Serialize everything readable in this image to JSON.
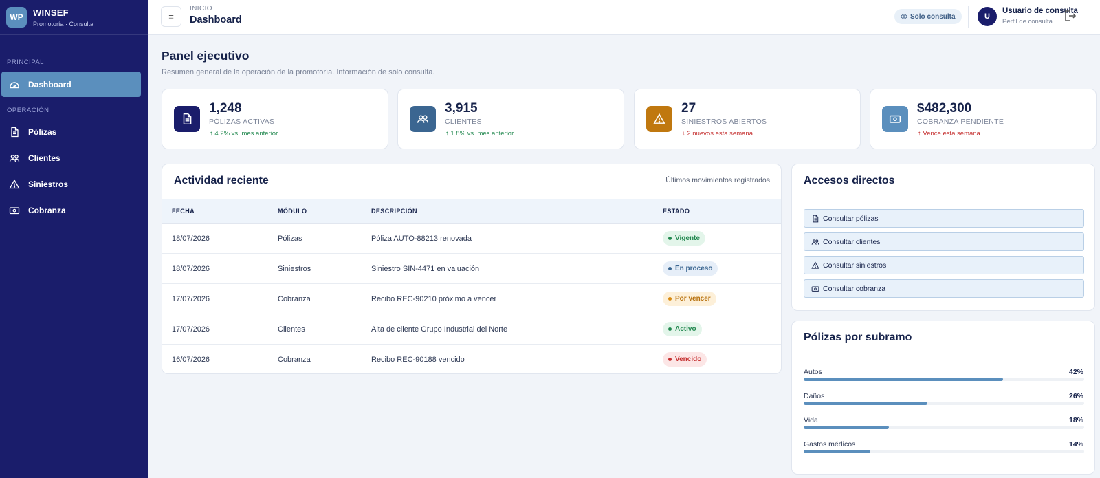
{
  "brand": {
    "logo": "WP",
    "name": "WINSEF",
    "subtitle": "Promotoría · Consulta"
  },
  "sidebar": {
    "section_principal": "PRINCIPAL",
    "section_operacion": "OPERACIÓN",
    "items": [
      {
        "label": "Dashboard",
        "icon": "gauge-icon",
        "active": true
      },
      {
        "label": "Pólizas",
        "icon": "document-icon"
      },
      {
        "label": "Clientes",
        "icon": "users-icon"
      },
      {
        "label": "Siniestros",
        "icon": "warning-icon"
      },
      {
        "label": "Cobranza",
        "icon": "cash-icon"
      }
    ]
  },
  "header": {
    "breadcrumb": "INICIO",
    "title": "Dashboard",
    "readonly_badge": "Solo consulta",
    "user_initial": "U",
    "user_name": "Usuario de consulta",
    "user_role": "Perfil de consulta"
  },
  "main": {
    "title": "Panel ejecutivo",
    "subtitle": "Resumen general de la operación de la promotoría. Información de solo consulta."
  },
  "kpis": [
    {
      "value": "1,248",
      "label": "PÓLIZAS ACTIVAS",
      "trend": "↑ 4.2% vs. mes anterior",
      "direction": "up",
      "icon": "document-icon",
      "color": "#1a1d6b"
    },
    {
      "value": "3,915",
      "label": "CLIENTES",
      "trend": "↑ 1.8% vs. mes anterior",
      "direction": "up",
      "icon": "users-icon",
      "color": "#3b6691"
    },
    {
      "value": "27",
      "label": "SINIESTROS ABIERTOS",
      "trend": "↓ 2 nuevos esta semana",
      "direction": "down",
      "icon": "warning-icon",
      "color": "#c0780f"
    },
    {
      "value": "$482,300",
      "label": "COBRANZA PENDIENTE",
      "trend": "↑ Vence esta semana",
      "direction": "down",
      "icon": "cash-icon",
      "color": "#5b8fbd"
    }
  ],
  "activity": {
    "title": "Actividad reciente",
    "meta": "Últimos movimientos registrados",
    "columns": [
      "FECHA",
      "MÓDULO",
      "DESCRIPCIÓN",
      "ESTADO"
    ],
    "rows": [
      {
        "fecha": "18/07/2026",
        "modulo": "Pólizas",
        "descripcion": "Póliza AUTO-88213 renovada",
        "estado": "Vigente",
        "estado_bg": "#e3f5ea",
        "estado_fg": "#22884f"
      },
      {
        "fecha": "18/07/2026",
        "modulo": "Siniestros",
        "descripcion": "Siniestro SIN-4471 en valuación",
        "estado": "En proceso",
        "estado_bg": "#e6eef8",
        "estado_fg": "#3b6691"
      },
      {
        "fecha": "17/07/2026",
        "modulo": "Cobranza",
        "descripcion": "Recibo REC-90210 próximo a vencer",
        "estado": "Por vencer",
        "estado_bg": "#fdf0d9",
        "estado_fg": "#b7700c"
      },
      {
        "fecha": "17/07/2026",
        "modulo": "Clientes",
        "descripcion": "Alta de cliente Grupo Industrial del Norte",
        "estado": "Activo",
        "estado_bg": "#e3f5ea",
        "estado_fg": "#22884f"
      },
      {
        "fecha": "16/07/2026",
        "modulo": "Cobranza",
        "descripcion": "Recibo REC-90188 vencido",
        "estado": "Vencido",
        "estado_bg": "#fce6e6",
        "estado_fg": "#c53030"
      }
    ]
  },
  "quick_access": {
    "title": "Accesos directos",
    "links": [
      {
        "label": "Consultar pólizas",
        "icon": "document-icon"
      },
      {
        "label": "Consultar clientes",
        "icon": "users-icon"
      },
      {
        "label": "Consultar siniestros",
        "icon": "warning-icon"
      },
      {
        "label": "Consultar cobranza",
        "icon": "cash-icon"
      }
    ]
  },
  "subramo": {
    "title": "Pólizas por subramo",
    "items": [
      {
        "label": "Autos",
        "percent": 42,
        "percent_label": "42%"
      },
      {
        "label": "Daños",
        "percent": 26,
        "percent_label": "26%"
      },
      {
        "label": "Vida",
        "percent": 18,
        "percent_label": "18%"
      },
      {
        "label": "Gastos médicos",
        "percent": 14,
        "percent_label": "14%"
      }
    ]
  }
}
